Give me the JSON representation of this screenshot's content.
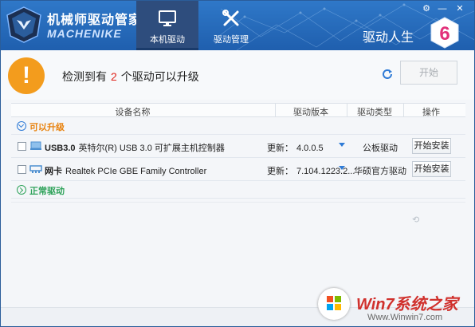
{
  "header": {
    "brand_cn": "机械师驱动管家",
    "brand_en": "MACHENIKE",
    "nav": [
      {
        "label": "本机驱动",
        "icon": "monitor-icon",
        "active": true
      },
      {
        "label": "驱动管理",
        "icon": "tools-icon",
        "active": false
      }
    ],
    "slogan": "驱动人生",
    "badge": "6",
    "window_controls": [
      "settings-icon",
      "minimize-icon",
      "close-icon"
    ]
  },
  "status": {
    "prefix": "检测到有",
    "count": "2",
    "suffix": "个驱动可以升级",
    "start_label": "开始",
    "warning_symbol": "!"
  },
  "table": {
    "columns": [
      "设备名称",
      "驱动版本",
      "驱动类型",
      "操作"
    ],
    "groups": [
      {
        "label": "可以升级",
        "rows": [
          {
            "name_bold": "USB3.0",
            "name": "英特尔(R) USB 3.0 可扩展主机控制器",
            "ver_label": "更新：",
            "version": "4.0.0.5",
            "type": "公板驱动",
            "action": "开始安装",
            "icon": "usb-icon"
          },
          {
            "name_bold": "网卡",
            "name": "Realtek PCIe GBE Family Controller",
            "ver_label": "更新：",
            "version": "7.104.1223.2...",
            "type": "华硕官方驱动",
            "action": "开始安装",
            "icon": "network-icon"
          }
        ]
      },
      {
        "label": "正常驱动",
        "rows": []
      }
    ]
  },
  "watermark": {
    "title": "Win7系统之家",
    "url": "Www.Winwin7.com"
  },
  "colors": {
    "header": "#2a6dbe",
    "accent": "#2f7bd6",
    "warning": "#f39c1d",
    "count": "#e0241b",
    "upgrade_group": "#e8820e",
    "normal_group": "#2fa35b"
  }
}
